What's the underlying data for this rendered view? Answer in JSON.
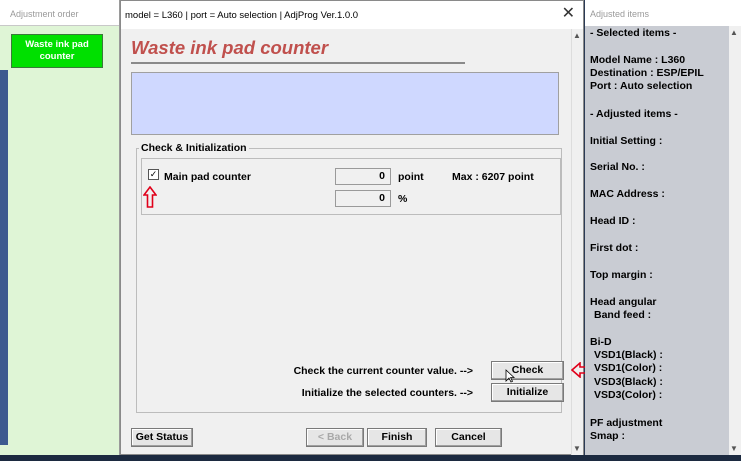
{
  "left_pane": {
    "title": "Adjustment order",
    "item_label": "Waste ink pad counter"
  },
  "dialog": {
    "title": "model = L360 | port = Auto selection | AdjProg Ver.1.0.0",
    "close_glyph": "✕",
    "heading": "Waste ink pad counter",
    "group_title": "Check & Initialization",
    "main_pad": {
      "checked": true,
      "check_glyph": "✓",
      "label": "Main pad counter",
      "point_value": "0",
      "point_unit": "point",
      "percent_value": "0",
      "percent_unit": "%",
      "max_text": "Max : 6207 point"
    },
    "check_hint": "Check the current counter value. -->",
    "check_button": "Check",
    "init_hint": "Initialize the selected counters. -->",
    "init_button": "Initialize",
    "get_status_button": "Get Status",
    "back_button": "< Back",
    "finish_button": "Finish",
    "cancel_button": "Cancel"
  },
  "right_pane": {
    "title": "Adjusted items",
    "items": [
      "- Selected items -",
      "Model Name : L360",
      "Destination : ESP/EPIL",
      "Port : Auto selection",
      "- Adjusted items -",
      "Initial Setting :",
      "Serial No. :",
      "MAC Address :",
      "Head ID :",
      "First dot :",
      "Top margin :",
      "Head angular",
      "Band feed :",
      "Bi-D",
      "VSD1(Black) :",
      "VSD1(Color) :",
      "VSD3(Black) :",
      "VSD3(Color) :",
      "PF adjustment",
      "Smap :"
    ]
  },
  "colors": {
    "heading": "#c0504d",
    "info_box": "#cfd8ff",
    "left_item": "#00e000",
    "left_pane_bg": "#dff5d6",
    "right_pane_bg": "#c9ccd3",
    "annotation_arrow": "#e0001a"
  }
}
